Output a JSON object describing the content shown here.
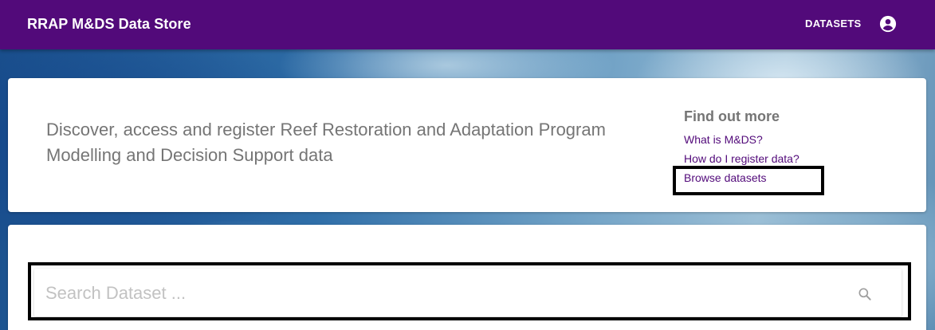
{
  "header": {
    "title": "RRAP M&DS Data Store",
    "nav_datasets": "DATASETS",
    "account_icon": "account-circle-icon"
  },
  "intro": {
    "text": "Discover, access and register Reef Restoration and Adaptation Program Modelling and Decision Support data"
  },
  "find_out_more": {
    "title": "Find out more",
    "links": [
      {
        "label": "What is M&DS?"
      },
      {
        "label": "How do I register data?"
      },
      {
        "label": "Browse datasets"
      }
    ]
  },
  "search": {
    "placeholder": "Search Dataset ...",
    "value": "",
    "icon": "search-icon"
  },
  "colors": {
    "brand": "#520a7a",
    "link": "#520a7a",
    "text_muted": "#757575"
  }
}
